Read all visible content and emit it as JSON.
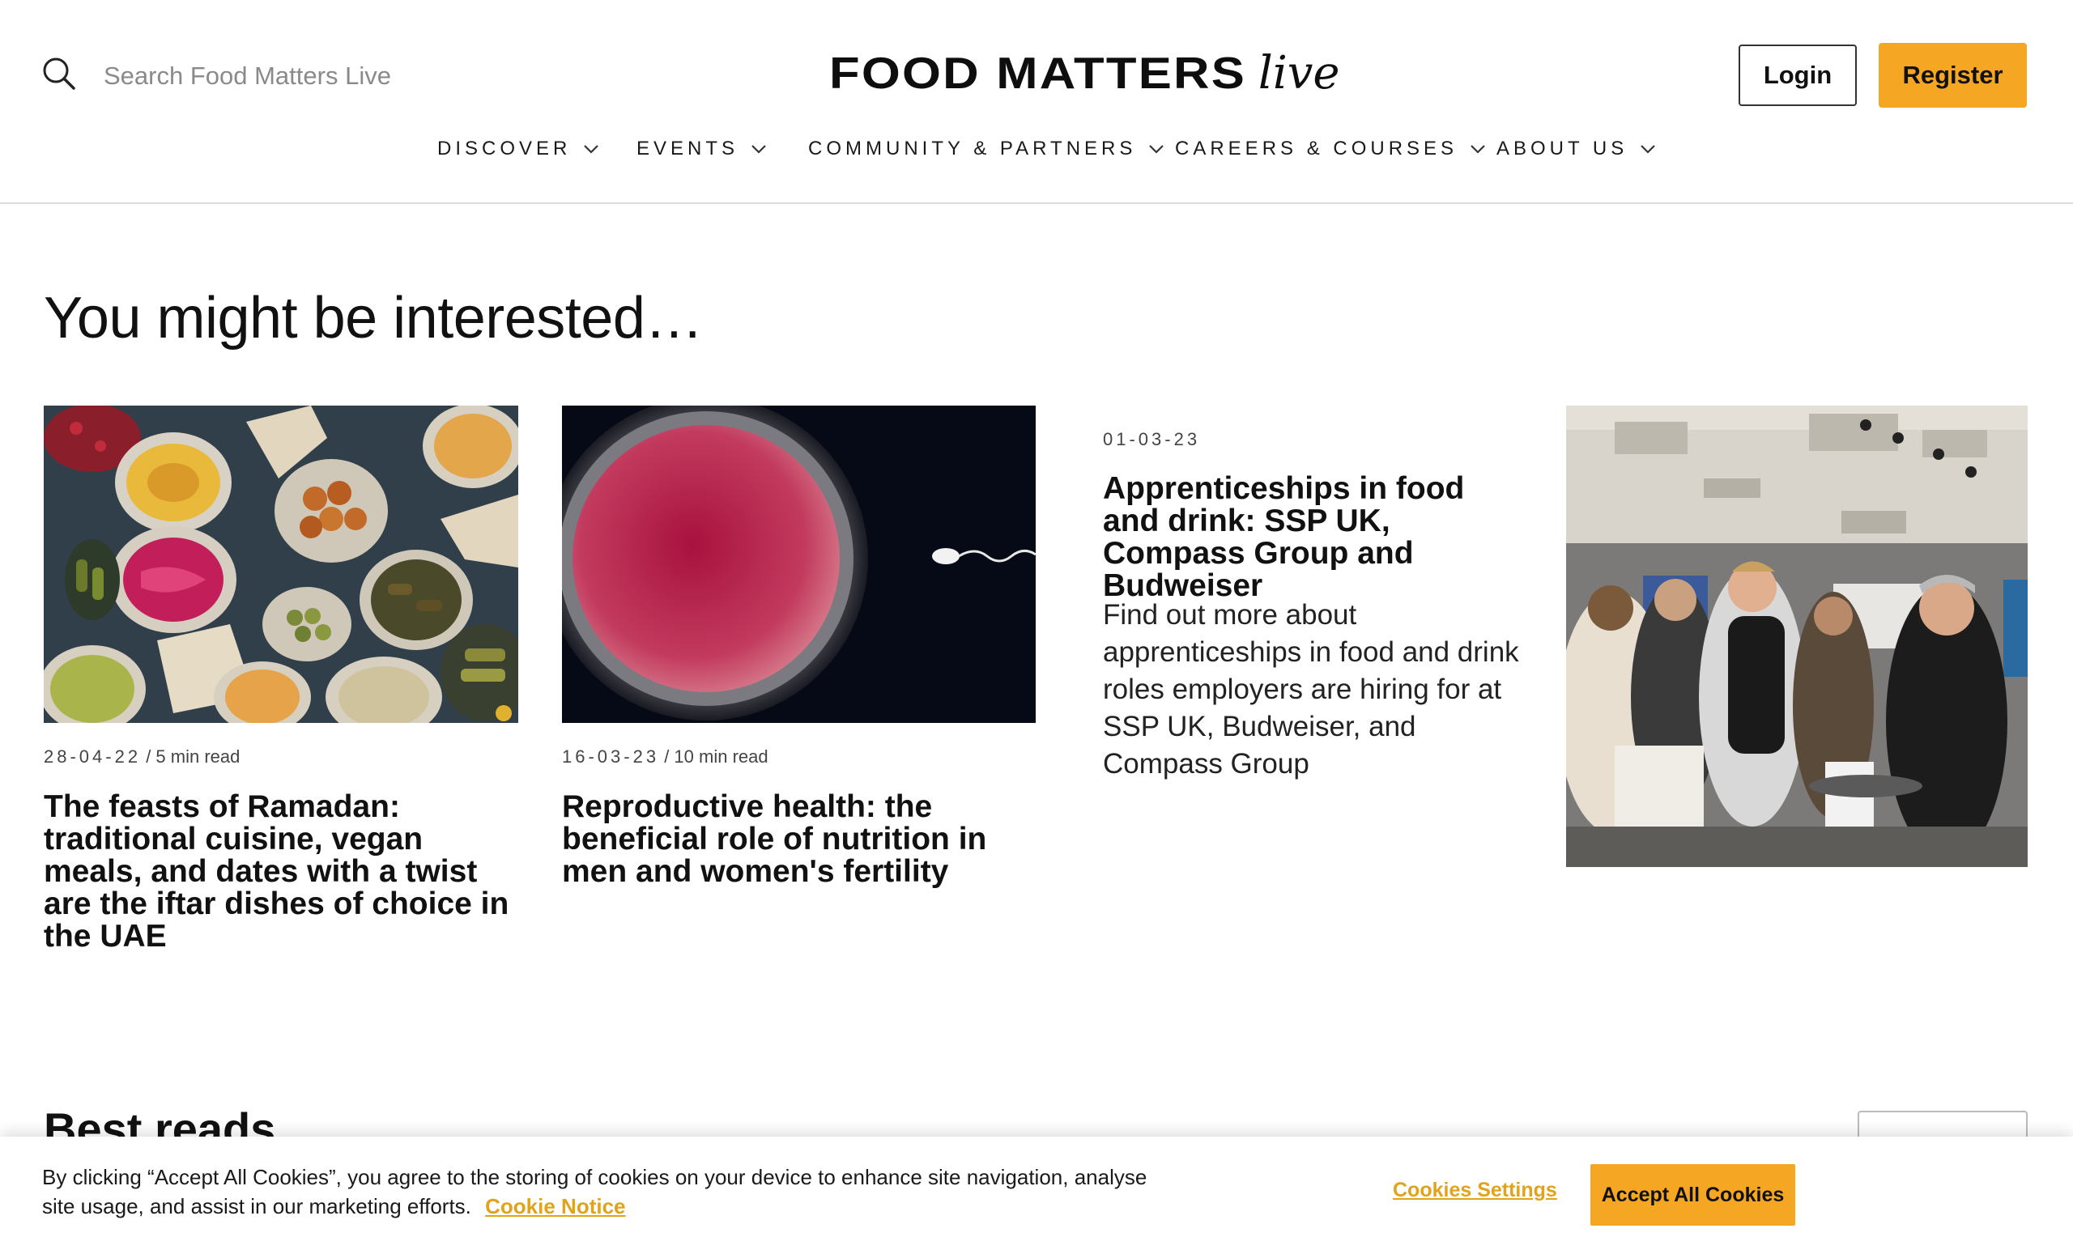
{
  "search": {
    "placeholder": "Search Food Matters Live"
  },
  "logo": {
    "main": "FOOD MATTERS",
    "accent": "live"
  },
  "header": {
    "login_label": "Login",
    "register_label": "Register"
  },
  "nav": {
    "items": [
      {
        "label": "DISCOVER"
      },
      {
        "label": "EVENTS"
      },
      {
        "label": "COMMUNITY & PARTNERS"
      },
      {
        "label": "CAREERS & COURSES"
      },
      {
        "label": "ABOUT US"
      }
    ]
  },
  "section": {
    "title": "You might be interested…"
  },
  "cards": [
    {
      "date": "28-04-22",
      "read_time": "/ 5 min read",
      "title": "The feasts of Ramadan: traditional cuisine, vegan meals, and dates with a twist are the iftar dishes of choice in the UAE"
    },
    {
      "date": "16-03-23",
      "read_time": "/ 10 min read",
      "title": "Reproductive health: the beneficial role of nutrition in men and women's fertility"
    },
    {
      "date": "01-03-23",
      "title": "Apprenticeships in food and drink: SSP UK, Compass Group and Budweiser",
      "description": "Find out more about apprenticeships in food and drink roles employers are hiring for at SSP UK, Budweiser, and Compass Group"
    }
  ],
  "best_reads": {
    "title": "Best reads"
  },
  "cookie": {
    "text": "By clicking “Accept All Cookies”, you agree to the storing of cookies on your device to enhance site navigation, analyse site usage, and assist in our marketing efforts.",
    "notice_label": "Cookie Notice",
    "settings_label": "Cookies Settings",
    "accept_label": "Accept All Cookies"
  },
  "colors": {
    "accent": "#f5a623",
    "link": "#e0a31a",
    "text": "#111111"
  }
}
